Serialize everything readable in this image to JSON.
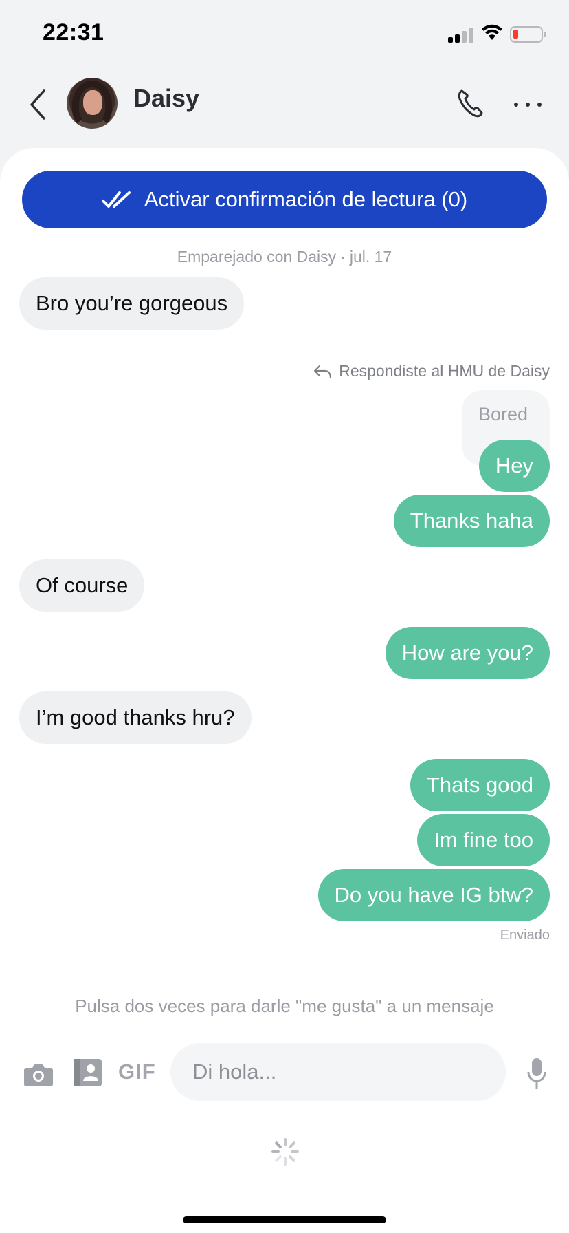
{
  "status_bar": {
    "time": "22:31"
  },
  "header": {
    "contact_name": "Daisy"
  },
  "banner": {
    "label": "Activar confirmación de lectura (0)"
  },
  "match_info": {
    "text": "Emparejado con Daisy",
    "separator": "·",
    "date": "jul. 17"
  },
  "reply_note": {
    "text": "Respondiste al HMU de Daisy",
    "quoted": "Bored"
  },
  "messages": [
    {
      "direction": "in",
      "text": "Bro you’re gorgeous"
    },
    {
      "direction": "out",
      "text": "Hey"
    },
    {
      "direction": "out",
      "text": "Thanks haha"
    },
    {
      "direction": "in",
      "text": "Of course"
    },
    {
      "direction": "out",
      "text": "How are you?"
    },
    {
      "direction": "in",
      "text": "I’m good thanks hru?"
    },
    {
      "direction": "out",
      "text": "Thats good"
    },
    {
      "direction": "out",
      "text": "Im fine too"
    },
    {
      "direction": "out",
      "text": "Do you have IG btw?"
    }
  ],
  "sent_status": "Enviado",
  "hint": "Pulsa dos veces para darle \"me gusta\" a un mensaje",
  "input": {
    "gif_label": "GIF",
    "placeholder": "Di hola...",
    "value": ""
  },
  "colors": {
    "banner": "#1c45c4",
    "outgoing": "#5cc3a1",
    "incoming": "#eff0f2"
  },
  "icons": [
    "back-chevron-icon",
    "phone-icon",
    "more-dots-icon",
    "double-check-icon",
    "reply-arrow-icon",
    "camera-icon",
    "contact-card-icon",
    "microphone-icon",
    "loading-spinner-icon"
  ]
}
